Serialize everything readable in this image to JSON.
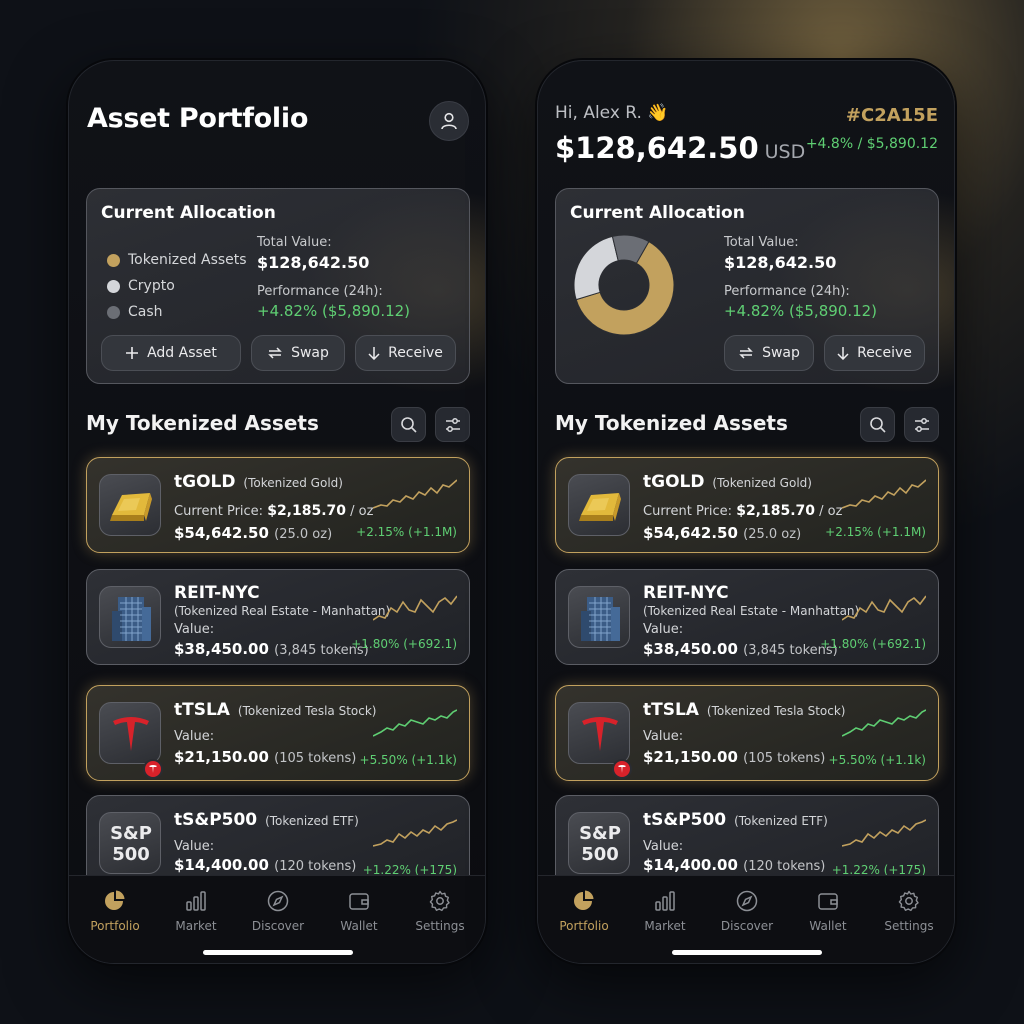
{
  "left": {
    "title": "Asset Portfolio",
    "allocation": {
      "title": "Current Allocation",
      "legend": [
        {
          "label": "Tokenized Assets",
          "color": "#c2a15e"
        },
        {
          "label": "Crypto",
          "color": "#d4d6da"
        },
        {
          "label": "Cash",
          "color": "#6b6e75"
        }
      ],
      "total_label": "Total Value:",
      "total_value": "$128,642.50",
      "performance_label": "Performance (24h):",
      "performance_value": "+4.82% ($5,890.12)",
      "buttons": {
        "add": "Add Asset",
        "swap": "Swap",
        "receive": "Receive"
      }
    }
  },
  "right": {
    "greeting": "Hi, Alex R. 👋",
    "balance": "$128,642.50",
    "balance_unit": "USD",
    "accent_code": "#C2A15E",
    "balance_change": "+4.8% / $5,890.12",
    "allocation": {
      "title": "Current Allocation",
      "donut": [
        {
          "label": "Tokenized Assets",
          "share": 0.62,
          "color": "#c2a15e"
        },
        {
          "label": "Crypto",
          "share": 0.26,
          "color": "#d4d6da"
        },
        {
          "label": "Cash",
          "share": 0.12,
          "color": "#6b6e75"
        }
      ],
      "total_label": "Total Value:",
      "total_value": "$128,642.50",
      "performance_label": "Performance (24h):",
      "performance_value": "+4.82% ($5,890.12)",
      "buttons": {
        "swap": "Swap",
        "receive": "Receive"
      }
    }
  },
  "section_title": "My Tokenized Assets",
  "assets": [
    {
      "icon": "gold-bar-icon",
      "name": "tGOLD",
      "subtitle": "(Tokenized Gold)",
      "line2_label": "Current Price:",
      "line2_value": "$2,185.70",
      "line2_suffix": "/ oz",
      "value": "$54,642.50",
      "qty": "(25.0 oz)",
      "change": "+2.15% (+1.1M)",
      "highlight": true,
      "spark_color": "#c2a15e"
    },
    {
      "icon": "building-icon",
      "name": "REIT-NYC",
      "subtitle": "(Tokenized Real Estate - Manhattan)",
      "line2_label": "Value:",
      "value": "$38,450.00",
      "qty": "(3,845 tokens)",
      "change": "+1.80% (+692.1)",
      "highlight": false,
      "spark_color": "#c2a15e"
    },
    {
      "icon": "tesla-logo-icon",
      "name": "tTSLA",
      "subtitle": "(Tokenized Tesla Stock)",
      "line2_label": "Value:",
      "value": "$21,150.00",
      "qty": "(105 tokens)",
      "change": "+5.50% (+1.1k)",
      "highlight": true,
      "spark_color": "#5fcf73"
    },
    {
      "icon": "sp500-icon",
      "icon_text": "S&P 500",
      "name": "tS&P500",
      "subtitle": "(Tokenized ETF)",
      "line2_label": "Value:",
      "value": "$14,400.00",
      "qty": "(120 tokens)",
      "change": "+1.22% (+175)",
      "highlight": false,
      "spark_color": "#c2a15e"
    }
  ],
  "tabs": [
    {
      "label": "Portfolio",
      "icon": "pie-chart-icon",
      "active": true
    },
    {
      "label": "Market",
      "icon": "bar-chart-icon",
      "active": false
    },
    {
      "label": "Discover",
      "icon": "compass-icon",
      "active": false
    },
    {
      "label": "Wallet",
      "icon": "wallet-icon",
      "active": false
    },
    {
      "label": "Settings",
      "icon": "gear-icon",
      "active": false
    }
  ],
  "colors": {
    "accent": "#c2a15e",
    "positive": "#5fcf73",
    "background": "#0e1117"
  }
}
